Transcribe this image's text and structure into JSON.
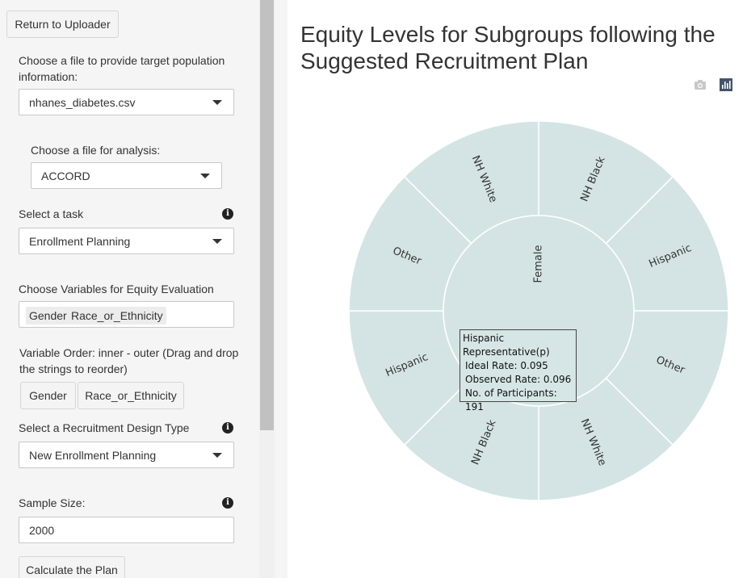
{
  "sidebar": {
    "return_button": "Return to Uploader",
    "target_file_label": "Choose a file to provide target population information:",
    "target_file_value": "nhanes_diabetes.csv",
    "analysis_file_label": "Choose a file for analysis:",
    "analysis_file_value": "ACCORD",
    "task_label": "Select a task",
    "task_value": "Enrollment Planning",
    "equity_vars_label": "Choose Variables for Equity Evaluation",
    "equity_vars": [
      "Gender",
      "Race_or_Ethnicity"
    ],
    "order_label": "Variable Order: inner - outer (Drag and drop the strings to reorder)",
    "order_items": [
      "Gender",
      "Race_or_Ethnicity"
    ],
    "design_label": "Select a Recruitment Design Type",
    "design_value": "New Enrollment Planning",
    "sample_size_label": "Sample Size:",
    "sample_size_value": "2000",
    "calculate_button": "Calculate the Plan"
  },
  "main": {
    "title": "Equity Levels for Subgroups following the Suggested Recruitment Plan",
    "toolbar": {
      "camera_icon": "camera-icon",
      "plotly_icon": "bar-chart-icon"
    }
  },
  "chart_data": {
    "type": "sunburst",
    "colors": {
      "fill": "#d4e4e4",
      "border": "#ffffff"
    },
    "inner": [
      "Female"
    ],
    "outer": [
      "NH Black",
      "Hispanic",
      "Other",
      "NH White",
      "NH Black",
      "Hispanic",
      "Other",
      "NH White"
    ],
    "tooltip": {
      "title": "Hispanic",
      "line2": "Representative(p)",
      "ideal_rate": "Ideal Rate: 0.095",
      "observed_rate": "Observed Rate: 0.096",
      "participants": "No. of Participants: 191"
    }
  }
}
